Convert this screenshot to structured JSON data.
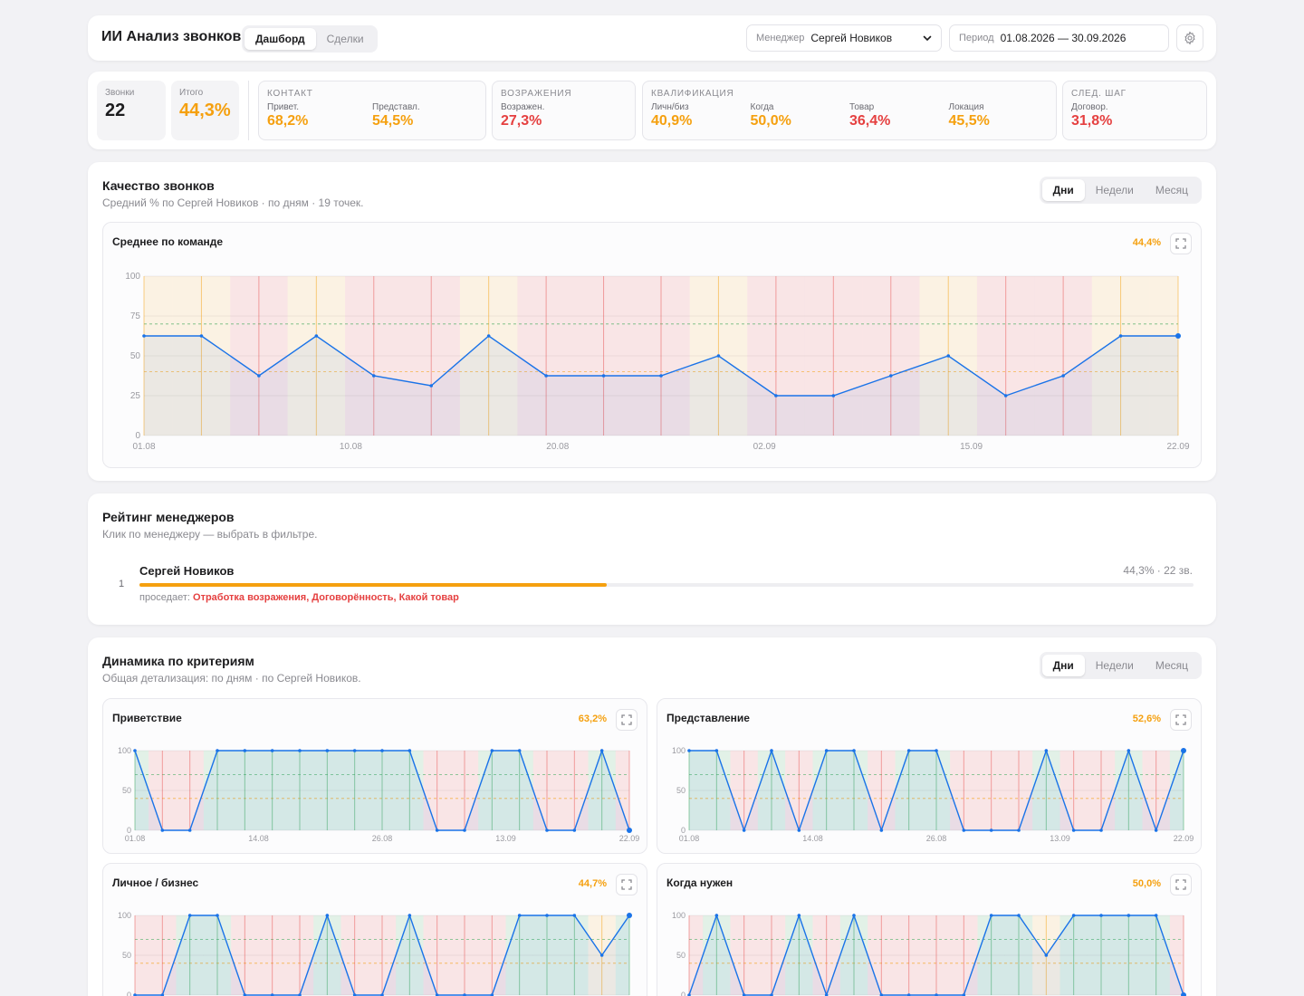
{
  "app": {
    "title": "ИИ Анализ звонков",
    "tabs": [
      "Дашборд",
      "Сделки"
    ],
    "active_tab": 0,
    "manager_label": "Менеджер",
    "manager_value": "Сергей Новиков",
    "period_label": "Период",
    "period_value": "01.08.2026 — 30.09.2026"
  },
  "metrics": {
    "calls": {
      "label": "Звонки",
      "value": "22"
    },
    "total": {
      "label": "Итого",
      "value": "44,3%"
    },
    "groups": [
      {
        "title": "КОНТАКТ",
        "items": [
          {
            "label": "Привет.",
            "value": "68,2%",
            "color": "orange"
          },
          {
            "label": "Представл.",
            "value": "54,5%",
            "color": "orange"
          }
        ]
      },
      {
        "title": "ВОЗРАЖЕНИЯ",
        "items": [
          {
            "label": "Возражен.",
            "value": "27,3%",
            "color": "red"
          }
        ]
      },
      {
        "title": "КВАЛИФИКАЦИЯ",
        "items": [
          {
            "label": "Личн/биз",
            "value": "40,9%",
            "color": "orange"
          },
          {
            "label": "Когда",
            "value": "50,0%",
            "color": "orange"
          },
          {
            "label": "Товар",
            "value": "36,4%",
            "color": "red"
          },
          {
            "label": "Локация",
            "value": "45,5%",
            "color": "orange"
          }
        ]
      },
      {
        "title": "СЛЕД. ШАГ",
        "items": [
          {
            "label": "Договор.",
            "value": "31,8%",
            "color": "red"
          }
        ]
      }
    ]
  },
  "quality": {
    "title": "Качество звонков",
    "subtitle": "Средний % по Сергей Новиков · по дням · 19 точек.",
    "period_tabs": [
      "Дни",
      "Недели",
      "Месяц"
    ],
    "active_period": 0
  },
  "colors": {
    "line": "#1a73e8",
    "orange": "#f5a00f",
    "red": "#e54040",
    "green": "#34a853"
  },
  "chart_data": [
    {
      "type": "line",
      "title": "Среднее по команде",
      "value_label": "44,4%",
      "x": [
        "01.08",
        "04.08",
        "07.08",
        "10.08",
        "13.08",
        "16.08",
        "20.08",
        "23.08",
        "26.08",
        "29.08",
        "02.09",
        "05.09",
        "08.09",
        "11.09",
        "14.09",
        "15.09",
        "18.09",
        "21.09",
        "22.09"
      ],
      "values": [
        62.5,
        62.5,
        37.5,
        62.5,
        37.5,
        31.25,
        62.5,
        37.5,
        37.5,
        37.5,
        50,
        25,
        25,
        37.5,
        50,
        25,
        37.5,
        62.5,
        62.5
      ],
      "x_tick_labels": [
        "01.08",
        "10.08",
        "20.08",
        "02.09",
        "15.09",
        "22.09"
      ],
      "y_ticks": [
        0,
        25,
        50,
        75,
        100
      ],
      "ylim": [
        0,
        100
      ],
      "thresholds": [
        70,
        40
      ],
      "grid": true
    },
    {
      "type": "line",
      "title": "Приветствие",
      "value_label": "63,2%",
      "values": [
        100,
        0,
        0,
        100,
        100,
        100,
        100,
        100,
        100,
        100,
        100,
        0,
        0,
        100,
        100,
        0,
        0,
        100,
        0
      ],
      "x_tick_labels": [
        "01.08",
        "14.08",
        "26.08",
        "13.09",
        "22.09"
      ],
      "y_ticks": [
        0,
        50,
        100
      ],
      "ylim": [
        0,
        100
      ]
    },
    {
      "type": "line",
      "title": "Представление",
      "value_label": "52,6%",
      "values": [
        100,
        100,
        0,
        100,
        0,
        100,
        100,
        0,
        100,
        100,
        0,
        0,
        0,
        100,
        0,
        0,
        100,
        0,
        100
      ],
      "x_tick_labels": [
        "01.08",
        "14.08",
        "26.08",
        "13.09",
        "22.09"
      ],
      "y_ticks": [
        0,
        50,
        100
      ],
      "ylim": [
        0,
        100
      ]
    },
    {
      "type": "line",
      "title": "Личное / бизнес",
      "value_label": "44,7%",
      "values": [
        0,
        0,
        100,
        100,
        0,
        0,
        0,
        100,
        0,
        0,
        100,
        0,
        0,
        0,
        100,
        100,
        100,
        50,
        100
      ],
      "y_ticks": [
        0,
        50,
        100
      ],
      "ylim": [
        0,
        100
      ]
    },
    {
      "type": "line",
      "title": "Когда нужен",
      "value_label": "50,0%",
      "values": [
        0,
        100,
        0,
        0,
        100,
        0,
        100,
        0,
        0,
        0,
        0,
        100,
        100,
        50,
        100,
        100,
        100,
        100,
        0
      ],
      "y_ticks": [
        0,
        50,
        100
      ],
      "ylim": [
        0,
        100
      ]
    }
  ],
  "rating": {
    "title": "Рейтинг менеджеров",
    "subtitle": "Клик по менеджеру — выбрать в фильтре.",
    "rows": [
      {
        "rank": "1",
        "name": "Сергей Новиков",
        "stat": "44,3% · 22 зв.",
        "score": 44.3,
        "weak_label": "проседает:",
        "weak_items": "Отработка возражения, Договорённость, Какой товар"
      }
    ]
  },
  "dynamics": {
    "title": "Динамика по критериям",
    "subtitle": "Общая детализация: по дням · по Сергей Новиков.",
    "period_tabs": [
      "Дни",
      "Недели",
      "Месяц"
    ],
    "active_period": 0
  }
}
